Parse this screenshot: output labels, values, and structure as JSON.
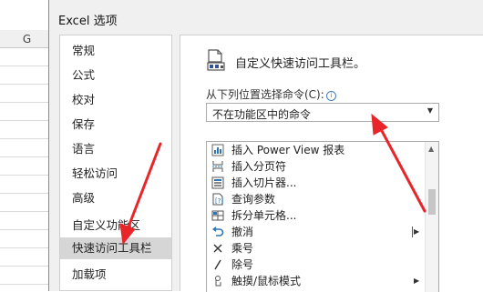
{
  "sheet": {
    "column_header": "G"
  },
  "dialog": {
    "title": "Excel 选项",
    "nav": [
      {
        "label": "常规"
      },
      {
        "label": "公式"
      },
      {
        "label": "校对"
      },
      {
        "label": "保存"
      },
      {
        "label": "语言"
      },
      {
        "label": "轻松访问"
      },
      {
        "label": "高级"
      },
      {
        "label": "自定义功能区"
      },
      {
        "label": "快速访问工具栏",
        "selected": true
      },
      {
        "label": "加载项"
      }
    ],
    "panel": {
      "section_title": "自定义快速访问工具栏。",
      "choose_label": "从下列位置选择命令(C):",
      "choose_value": "不在功能区中的命令",
      "commands": [
        {
          "label": "插入 Power View 报表",
          "icon": "power-view-icon"
        },
        {
          "label": "插入分页符",
          "icon": "page-break-icon"
        },
        {
          "label": "插入切片器...",
          "icon": "slicer-icon"
        },
        {
          "label": "查询参数",
          "icon": "query-parameters-icon"
        },
        {
          "label": "拆分单元格...",
          "icon": "split-cells-icon"
        },
        {
          "label": "撤消",
          "icon": "undo-icon",
          "has_split": true
        },
        {
          "label": "乘号",
          "icon": "multiply-icon"
        },
        {
          "label": "除号",
          "icon": "divide-icon"
        },
        {
          "label": "触摸/鼠标模式",
          "icon": "touch-mouse-icon",
          "has_submenu": true
        }
      ]
    }
  },
  "annotations": {
    "arrow_color": "#e8262a"
  }
}
